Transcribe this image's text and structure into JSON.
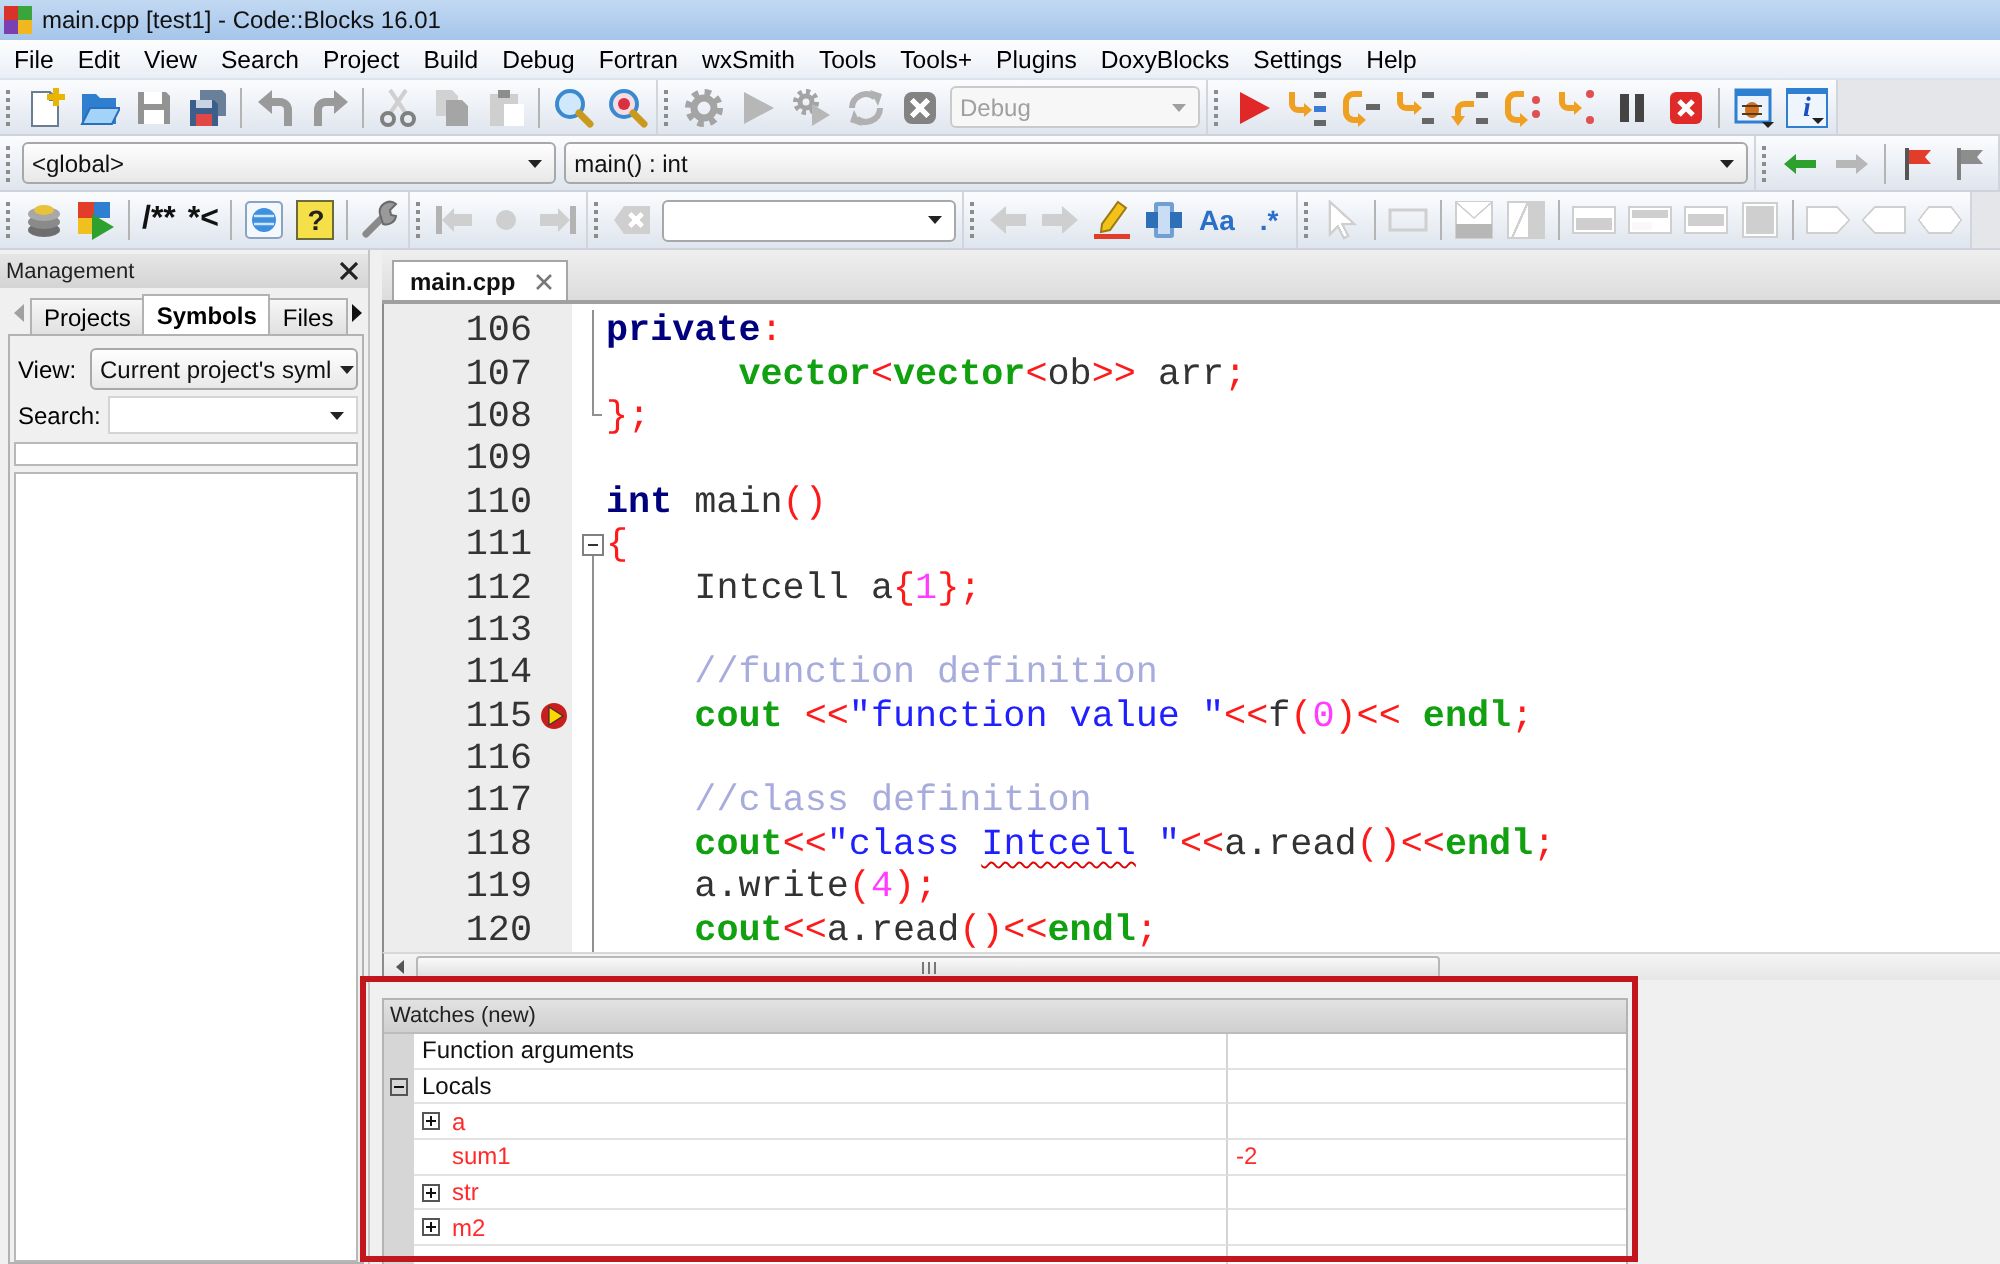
{
  "window": {
    "title": "main.cpp [test1] - Code::Blocks 16.01"
  },
  "menu": [
    "File",
    "Edit",
    "View",
    "Search",
    "Project",
    "Build",
    "Debug",
    "Fortran",
    "wxSmith",
    "Tools",
    "Tools+",
    "Plugins",
    "DoxyBlocks",
    "Settings",
    "Help"
  ],
  "toolbar_rows": [
    [
      {
        "items": [
          {
            "kind": "newfile",
            "disabled": false
          },
          {
            "kind": "open",
            "disabled": false
          },
          {
            "kind": "save",
            "disabled": true
          },
          {
            "kind": "saveall",
            "disabled": false
          },
          {
            "kind": "separator"
          },
          {
            "kind": "undo",
            "disabled": true
          },
          {
            "kind": "redo",
            "disabled": true
          },
          {
            "kind": "separator"
          },
          {
            "kind": "cut",
            "disabled": true
          },
          {
            "kind": "copy",
            "disabled": true
          },
          {
            "kind": "paste",
            "disabled": true
          },
          {
            "kind": "separator"
          },
          {
            "kind": "find",
            "disabled": false
          },
          {
            "kind": "replace",
            "disabled": false
          }
        ]
      },
      {
        "items": [
          {
            "kind": "build",
            "disabled": true
          },
          {
            "kind": "run",
            "disabled": true
          },
          {
            "kind": "buildrun",
            "disabled": true
          },
          {
            "kind": "rebuild",
            "disabled": true
          },
          {
            "kind": "abort",
            "disabled": true
          },
          {
            "kind": "combo",
            "value": "Debug",
            "disabled": true
          }
        ]
      },
      {
        "items": [
          {
            "kind": "debugrun",
            "disabled": false
          },
          {
            "kind": "runcursor",
            "disabled": false
          },
          {
            "kind": "nextline",
            "disabled": false
          },
          {
            "kind": "stepinto",
            "disabled": false
          },
          {
            "kind": "stepout",
            "disabled": false
          },
          {
            "kind": "nextinstr",
            "disabled": false
          },
          {
            "kind": "stepinstr",
            "disabled": false
          },
          {
            "kind": "pause",
            "disabled": false
          },
          {
            "kind": "stop",
            "disabled": false
          },
          {
            "kind": "separator"
          },
          {
            "kind": "debugwin",
            "disabled": false
          },
          {
            "kind": "infobox",
            "label": "i",
            "disabled": false
          }
        ]
      }
    ],
    [
      {
        "items": [
          {
            "kind": "combo",
            "value": "<global>",
            "disabled": false
          },
          {
            "kind": "combo",
            "value": "main() : int",
            "disabled": false
          }
        ]
      },
      {
        "items": [
          {
            "kind": "back",
            "disabled": false
          },
          {
            "kind": "forward",
            "disabled": true
          },
          {
            "kind": "separator"
          },
          {
            "kind": "flag",
            "disabled": false
          },
          {
            "kind": "flag",
            "disabled": true
          }
        ]
      }
    ],
    [
      {
        "items": [
          {
            "kind": "stack",
            "disabled": false
          },
          {
            "kind": "blocks",
            "disabled": false
          },
          {
            "kind": "separator"
          },
          {
            "kind": "text",
            "label": "/**",
            "disabled": false
          },
          {
            "kind": "text",
            "label": "*<",
            "disabled": false
          },
          {
            "kind": "separator"
          },
          {
            "kind": "globe",
            "disabled": false
          },
          {
            "kind": "helpbox",
            "label": "?",
            "disabled": false
          },
          {
            "kind": "separator"
          },
          {
            "kind": "wrench",
            "disabled": false
          }
        ]
      },
      {
        "items": [
          {
            "kind": "barleft",
            "disabled": true
          },
          {
            "kind": "dot",
            "disabled": true
          },
          {
            "kind": "barright",
            "disabled": true
          }
        ]
      },
      {
        "items": [
          {
            "kind": "clear",
            "disabled": true
          },
          {
            "kind": "combo",
            "disabled": false
          }
        ]
      },
      {
        "items": [
          {
            "kind": "left",
            "disabled": true
          },
          {
            "kind": "right",
            "disabled": true
          },
          {
            "kind": "highlight",
            "disabled": false
          },
          {
            "kind": "selection",
            "disabled": false
          },
          {
            "kind": "option",
            "label": "Aa",
            "disabled": false
          },
          {
            "kind": "option",
            "label": ".*",
            "disabled": false
          }
        ]
      },
      {
        "items": [
          {
            "kind": "pointer",
            "disabled": true
          },
          {
            "kind": "separator"
          },
          {
            "kind": "wxframe",
            "disabled": true
          },
          {
            "kind": "separator"
          },
          {
            "kind": "wxdialog",
            "disabled": true
          },
          {
            "kind": "wxscroll",
            "disabled": true
          },
          {
            "kind": "separator"
          },
          {
            "kind": "wxpanel1",
            "disabled": true
          },
          {
            "kind": "wxpanel2",
            "disabled": true
          },
          {
            "kind": "wxpanel3",
            "disabled": true
          },
          {
            "kind": "wxpanel4",
            "disabled": true
          },
          {
            "kind": "separator"
          },
          {
            "kind": "wxshape1",
            "disabled": true
          },
          {
            "kind": "wxshape2",
            "disabled": true
          },
          {
            "kind": "wxshape3",
            "disabled": true
          }
        ]
      }
    ]
  ],
  "management": {
    "title": "Management",
    "tabs": [
      {
        "label": "Projects",
        "selected": false
      },
      {
        "label": "Symbols",
        "selected": true
      },
      {
        "label": "Files",
        "selected": false
      }
    ],
    "view": {
      "label": "View:",
      "value": "Current project's syml"
    },
    "search": {
      "label": "Search:"
    }
  },
  "editor": {
    "tabs": [
      {
        "label": "main.cpp",
        "selected": true
      }
    ],
    "lines": [
      {
        "number": "106",
        "kind": "body",
        "breakpoint": false,
        "tokens": [
          {
            "kind": "keyword",
            "text": "private"
          },
          {
            "kind": "op",
            "text": ":"
          }
        ]
      },
      {
        "number": "107",
        "kind": "body",
        "breakpoint": false,
        "tokens": [
          {
            "kind": "type",
            "text": "      vector"
          },
          {
            "kind": "op",
            "text": "<"
          },
          {
            "kind": "type",
            "text": "vector"
          },
          {
            "kind": "op",
            "text": "<"
          },
          {
            "kind": "plain",
            "text": "ob"
          },
          {
            "kind": "op",
            "text": ">>"
          },
          {
            "kind": "plain",
            "text": " arr"
          },
          {
            "kind": "op",
            "text": ";"
          }
        ]
      },
      {
        "number": "108",
        "kind": "end",
        "breakpoint": false,
        "tokens": [
          {
            "kind": "op",
            "text": "};"
          }
        ]
      },
      {
        "number": "109",
        "kind": "outside",
        "breakpoint": false
      },
      {
        "number": "110",
        "kind": "outside",
        "breakpoint": false,
        "tokens": [
          {
            "kind": "keyword",
            "text": "int"
          },
          {
            "kind": "plain",
            "text": " main"
          },
          {
            "kind": "op",
            "text": "()"
          }
        ]
      },
      {
        "number": "111",
        "kind": "start",
        "breakpoint": false,
        "tokens": [
          {
            "kind": "op",
            "text": "{"
          }
        ]
      },
      {
        "number": "112",
        "kind": "body",
        "breakpoint": false,
        "tokens": [
          {
            "kind": "plain",
            "text": "    Intcell a"
          },
          {
            "kind": "op",
            "text": "{"
          },
          {
            "kind": "number",
            "text": "1"
          },
          {
            "kind": "op",
            "text": "};"
          }
        ]
      },
      {
        "number": "113",
        "kind": "body",
        "breakpoint": false
      },
      {
        "number": "114",
        "kind": "body",
        "breakpoint": false,
        "tokens": [
          {
            "kind": "comment",
            "text": "    //function definition"
          }
        ]
      },
      {
        "number": "115",
        "kind": "body",
        "breakpoint": true,
        "tokens": [
          {
            "kind": "type",
            "text": "    cout"
          },
          {
            "kind": "op",
            "text": " <<"
          },
          {
            "kind": "string",
            "text": "\"function value \""
          },
          {
            "kind": "op",
            "text": "<<"
          },
          {
            "kind": "plain",
            "text": "f"
          },
          {
            "kind": "op",
            "text": "("
          },
          {
            "kind": "number",
            "text": "0"
          },
          {
            "kind": "op",
            "text": ")<< "
          },
          {
            "kind": "type",
            "text": "endl"
          },
          {
            "kind": "op",
            "text": ";"
          }
        ]
      },
      {
        "number": "116",
        "kind": "body",
        "breakpoint": false
      },
      {
        "number": "117",
        "kind": "body",
        "breakpoint": false,
        "tokens": [
          {
            "kind": "comment",
            "text": "    //class definition"
          }
        ]
      },
      {
        "number": "118",
        "kind": "body",
        "breakpoint": false,
        "tokens": [
          {
            "kind": "type",
            "text": "    cout"
          },
          {
            "kind": "op",
            "text": "<<"
          },
          {
            "kind": "string",
            "text": "\"class "
          },
          {
            "kind": "misspelled",
            "text": "Intcell"
          },
          {
            "kind": "string",
            "text": " \""
          },
          {
            "kind": "op",
            "text": "<<"
          },
          {
            "kind": "plain",
            "text": "a.read"
          },
          {
            "kind": "op",
            "text": "()<<"
          },
          {
            "kind": "type",
            "text": "endl"
          },
          {
            "kind": "op",
            "text": ";"
          }
        ]
      },
      {
        "number": "119",
        "kind": "body",
        "breakpoint": false,
        "tokens": [
          {
            "kind": "plain",
            "text": "    a.write"
          },
          {
            "kind": "op",
            "text": "("
          },
          {
            "kind": "number",
            "text": "4"
          },
          {
            "kind": "op",
            "text": ");"
          }
        ]
      },
      {
        "number": "120",
        "kind": "body",
        "breakpoint": false,
        "tokens": [
          {
            "kind": "type",
            "text": "    cout"
          },
          {
            "kind": "op",
            "text": "<<"
          },
          {
            "kind": "plain",
            "text": "a.read"
          },
          {
            "kind": "op",
            "text": "()<<"
          },
          {
            "kind": "type",
            "text": "endl"
          },
          {
            "kind": "op",
            "text": ";"
          }
        ]
      }
    ]
  },
  "watches": {
    "title": "Watches (new)",
    "rows": [
      {
        "name": "Function arguments",
        "changed": false
      },
      {
        "name": "Locals",
        "changed": false,
        "expanded": true,
        "children": [
          {
            "name": "a",
            "changed": true,
            "expanded": false
          },
          {
            "name": "sum1",
            "value": "-2",
            "changed": true
          },
          {
            "name": "str",
            "changed": true,
            "expanded": false
          },
          {
            "name": "m2",
            "changed": true,
            "expanded": false
          }
        ]
      }
    ]
  }
}
